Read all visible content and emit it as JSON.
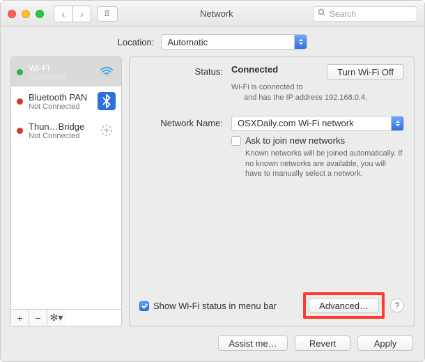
{
  "window": {
    "title": "Network"
  },
  "search": {
    "placeholder": "Search"
  },
  "location": {
    "label": "Location:",
    "value": "Automatic"
  },
  "services": [
    {
      "name": "Wi-Fi",
      "status": "Connected",
      "dot": "green",
      "icon": "wifi",
      "selected": true
    },
    {
      "name": "Bluetooth PAN",
      "status": "Not Connected",
      "dot": "red",
      "icon": "bluetooth",
      "selected": false
    },
    {
      "name": "Thun…Bridge",
      "status": "Not Connected",
      "dot": "red",
      "icon": "bridge",
      "selected": false
    }
  ],
  "sidebar_footer": {
    "add": "+",
    "remove": "−",
    "actions": "✻▾"
  },
  "details": {
    "status_label": "Status:",
    "status_value": "Connected",
    "wifi_off_btn": "Turn Wi-Fi Off",
    "status_desc_l1": "Wi-Fi is connected to",
    "status_desc_l2": "and has the IP address 192.168.0.4.",
    "network_name_label": "Network Name:",
    "network_name_value": "OSXDaily.com Wi-Fi network",
    "ask_join_label": "Ask to join new networks",
    "ask_join_desc": "Known networks will be joined automatically. If no known networks are available, you will have to manually select a network.",
    "show_status_label": "Show Wi-Fi status in menu bar",
    "advanced_btn": "Advanced…",
    "help": "?"
  },
  "footer": {
    "assist": "Assist me…",
    "revert": "Revert",
    "apply": "Apply"
  }
}
